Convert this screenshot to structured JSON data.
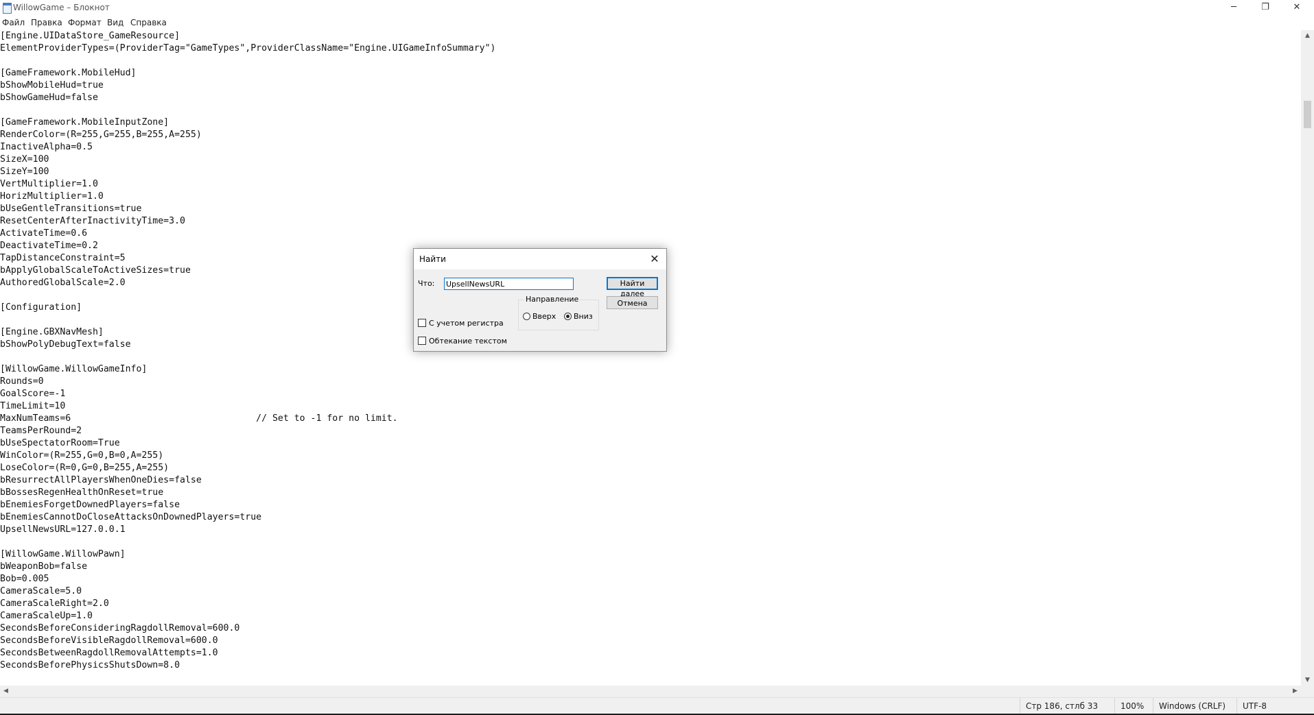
{
  "window": {
    "title": "WillowGame – Блокнот",
    "minimize_glyph": "─",
    "restore_glyph": "❐",
    "close_glyph": "✕"
  },
  "menu": [
    {
      "label": "Файл"
    },
    {
      "label": "Правка"
    },
    {
      "label": "Формат"
    },
    {
      "label": "Вид"
    },
    {
      "label": "Справка"
    }
  ],
  "editor": {
    "lines": [
      "[Engine.UIDataStore_GameResource]",
      "ElementProviderTypes=(ProviderTag=\"GameTypes\",ProviderClassName=\"Engine.UIGameInfoSummary\")",
      "",
      "[GameFramework.MobileHud]",
      "bShowMobileHud=true",
      "bShowGameHud=false",
      "",
      "[GameFramework.MobileInputZone]",
      "RenderColor=(R=255,G=255,B=255,A=255)",
      "InactiveAlpha=0.5",
      "SizeX=100",
      "SizeY=100",
      "VertMultiplier=1.0",
      "HorizMultiplier=1.0",
      "bUseGentleTransitions=true",
      "ResetCenterAfterInactivityTime=3.0",
      "ActivateTime=0.6",
      "DeactivateTime=0.2",
      "TapDistanceConstraint=5",
      "bApplyGlobalScaleToActiveSizes=true",
      "AuthoredGlobalScale=2.0",
      "",
      "[Configuration]",
      "",
      "[Engine.GBXNavMesh]",
      "bShowPolyDebugText=false",
      "",
      "[WillowGame.WillowGameInfo]",
      "Rounds=0",
      "GoalScore=-1",
      "TimeLimit=10",
      "MaxNumTeams=6                                  // Set to -1 for no limit.",
      "TeamsPerRound=2",
      "bUseSpectatorRoom=True",
      "WinColor=(R=255,G=0,B=0,A=255)",
      "LoseColor=(R=0,G=0,B=255,A=255)",
      "bResurrectAllPlayersWhenOneDies=false",
      "bBossesRegenHealthOnReset=true",
      "bEnemiesForgetDownedPlayers=false",
      "bEnemiesCannotDoCloseAttacksOnDownedPlayers=true",
      "UpsellNewsURL=127.0.0.1",
      "",
      "[WillowGame.WillowPawn]",
      "bWeaponBob=false",
      "Bob=0.005",
      "CameraScale=5.0",
      "CameraScaleRight=2.0",
      "CameraScaleUp=1.0",
      "SecondsBeforeConsideringRagdollRemoval=600.0",
      "SecondsBeforeVisibleRagdollRemoval=600.0",
      "SecondsBetweenRagdollRemovalAttempts=1.0",
      "SecondsBeforePhysicsShutsDown=8.0"
    ]
  },
  "find_dialog": {
    "title": "Найти",
    "close_glyph": "✕",
    "what_label": "Что:",
    "search_value": "UpsellNewsURL",
    "find_next_label": "Найти далее",
    "cancel_label": "Отмена",
    "direction_label": "Направление",
    "up_label": "Вверх",
    "down_label": "Вниз",
    "direction_selected": "down",
    "match_case_label": "С учетом регистра",
    "match_case_checked": false,
    "wrap_label": "Обтекание текстом",
    "wrap_checked": false
  },
  "statusbar": {
    "position": "Стр 186, стлб 33",
    "zoom": "100%",
    "line_endings": "Windows (CRLF)",
    "encoding": "UTF-8"
  },
  "scrollbars": {
    "up_glyph": "▲",
    "down_glyph": "▼",
    "left_glyph": "◀",
    "right_glyph": "▶"
  }
}
